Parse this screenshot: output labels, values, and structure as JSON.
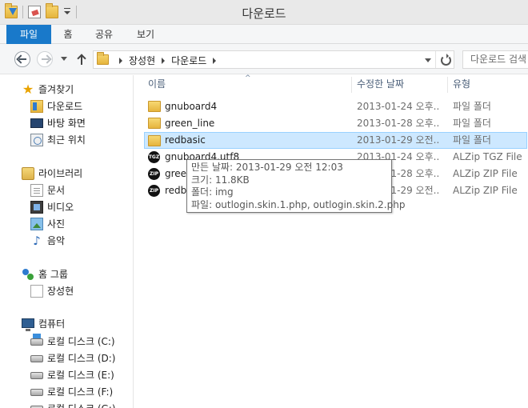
{
  "window": {
    "title": "다운로드"
  },
  "ribbon": {
    "tabs": [
      "파일",
      "홈",
      "공유",
      "보기"
    ]
  },
  "address": {
    "crumbs": [
      "장성현",
      "다운로드"
    ],
    "search_placeholder": "다운로드 검색"
  },
  "navpane": {
    "favorites": {
      "label": "즐겨찾기",
      "items": [
        "다운로드",
        "바탕 화면",
        "최근 위치"
      ]
    },
    "libraries": {
      "label": "라이브러리",
      "items": [
        "문서",
        "비디오",
        "사진",
        "음악"
      ]
    },
    "homegroup": {
      "label": "홈 그룹",
      "items": [
        "장성현"
      ]
    },
    "computer": {
      "label": "컴퓨터",
      "items": [
        "로컬 디스크 (C:)",
        "로컬 디스크 (D:)",
        "로컬 디스크 (E:)",
        "로컬 디스크 (F:)",
        "로컬 디스크 (G:)"
      ]
    }
  },
  "columns": {
    "name": "이름",
    "date": "수정한 날짜",
    "type": "유형"
  },
  "files": [
    {
      "name": "gnuboard4",
      "date": "2013-01-24 오후...",
      "type": "파일 폴더",
      "icon": "folder-icon"
    },
    {
      "name": "green_line",
      "date": "2013-01-28 오후...",
      "type": "파일 폴더",
      "icon": "folder-icon"
    },
    {
      "name": "redbasic",
      "date": "2013-01-29 오전...",
      "type": "파일 폴더",
      "icon": "folder-icon",
      "selected": true
    },
    {
      "name": "gnuboard4.utf8",
      "date": "2013-01-24 오후...",
      "type": "ALZip TGZ File",
      "icon": "tgz-icon",
      "badge": "TGZ"
    },
    {
      "name": "green_line",
      "date": "2013-01-28 오후...",
      "type": "ALZip ZIP File",
      "icon": "zip-icon",
      "badge": "ZIP"
    },
    {
      "name": "redbasic",
      "date": "2013-01-29 오전...",
      "type": "ALZip ZIP File",
      "icon": "zip-icon",
      "badge": "ZIP"
    }
  ],
  "tooltip": {
    "created": "만든 날짜: 2013-01-29 오전 12:03",
    "size": "크기: 11.8KB",
    "folders": "폴더: img",
    "files": "파일: outlogin.skin.1.php, outlogin.skin.2.php"
  }
}
